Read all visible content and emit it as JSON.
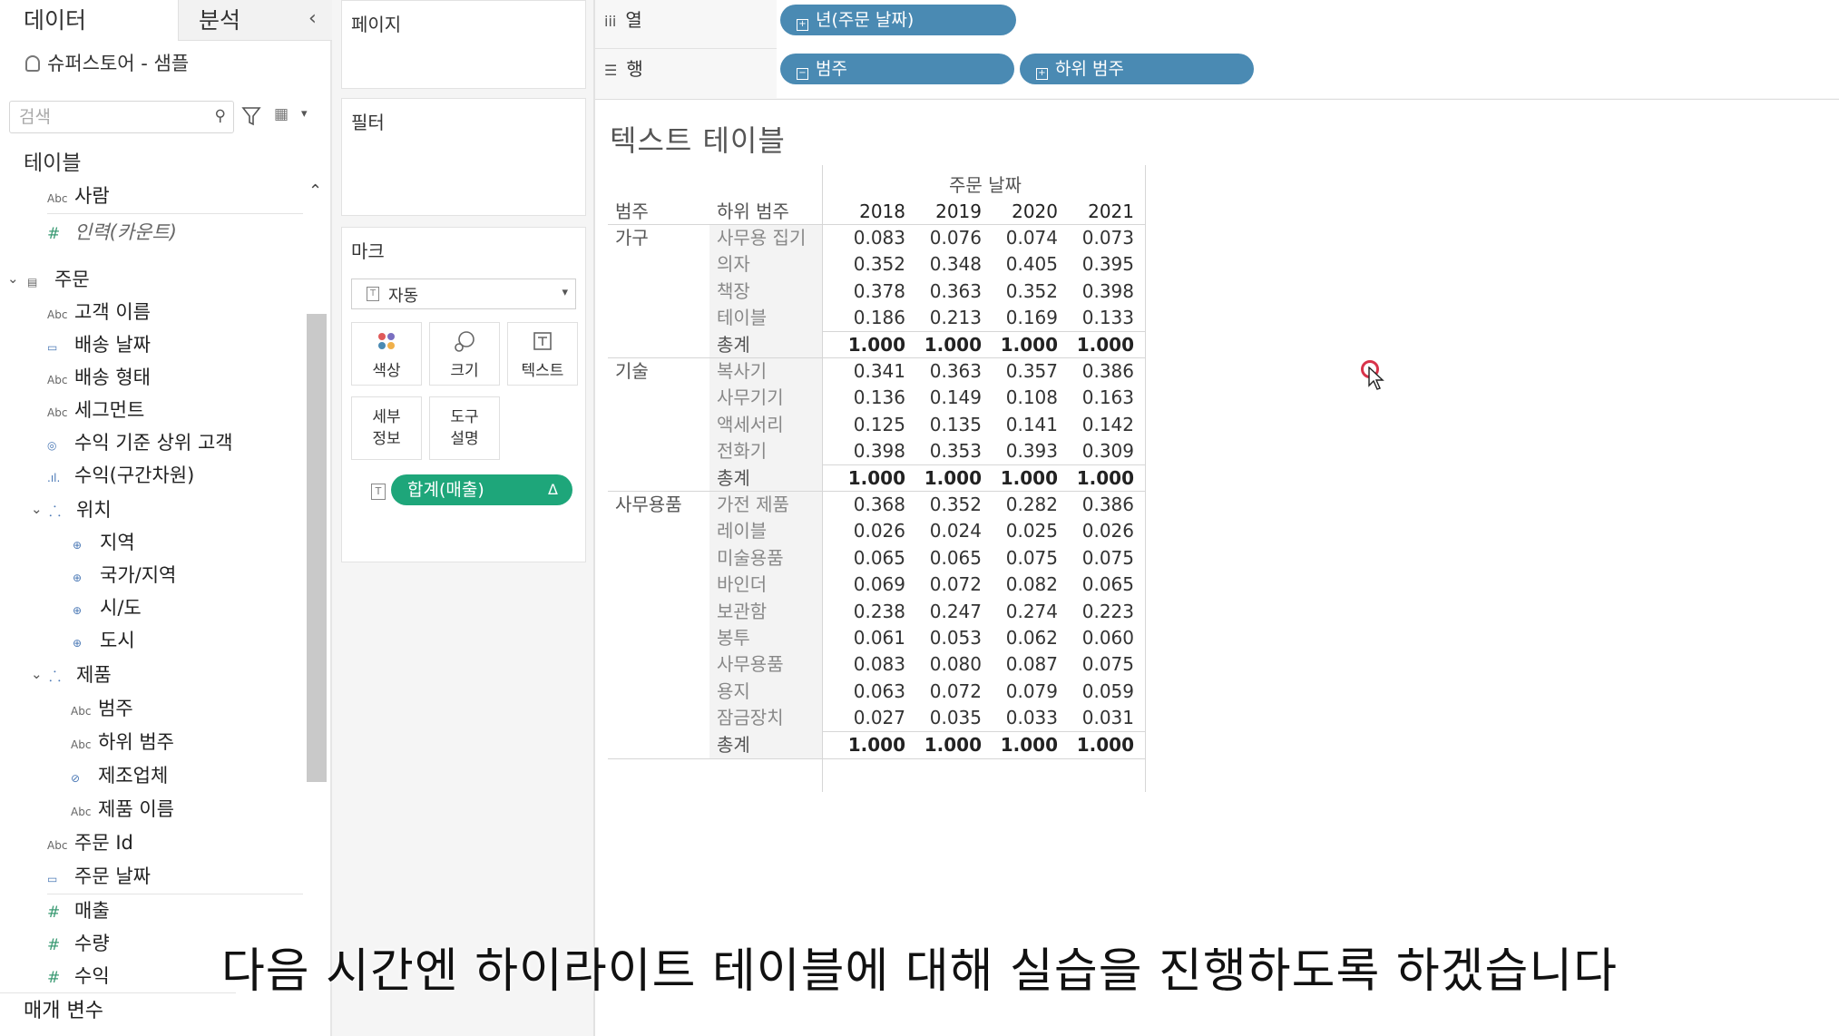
{
  "data_pane": {
    "tab_data": "데이터",
    "tab_analysis": "분석",
    "collapse_icon": "chevron-left-icon",
    "datasource": "슈퍼스토어 - 샘플",
    "search_placeholder": "검색",
    "tables_label": "테이블",
    "fields": {
      "person": "사람",
      "entry_count": "인력(카운트)",
      "orders": "주문",
      "customer_name": "고객 이름",
      "ship_date": "배송 날짜",
      "ship_mode": "배송 형태",
      "segment": "세그먼트",
      "top_customers": "수익 기준 상위 고객",
      "profit_bin": "수익(구간차원)",
      "location": "위치",
      "region": "지역",
      "country": "국가/지역",
      "state": "시/도",
      "city": "도시",
      "product": "제품",
      "category": "범주",
      "sub_category": "하위 범주",
      "manufacturer": "제조업체",
      "product_name": "제품 이름",
      "order_id": "주문 Id",
      "order_date": "주문 날짜",
      "sales": "매출",
      "quantity": "수량",
      "profit": "수익"
    },
    "parameters_label": "매개 변수"
  },
  "cards": {
    "pages": "페이지",
    "filters": "필터",
    "marks": "마크",
    "mark_type": "자동",
    "color": "색상",
    "size": "크기",
    "text": "텍스트",
    "detail_1": "세부",
    "detail_2": "정보",
    "tooltip_1": "도구",
    "tooltip_2": "설명",
    "sum_pill": "합계(매출)",
    "sum_pill_delta": "Δ"
  },
  "shelves": {
    "columns_label": "열",
    "rows_label": "행",
    "columns_pill": "년(주문 날짜)",
    "rows_pill_1": "범주",
    "rows_pill_2": "하위 범주"
  },
  "view": {
    "title": "텍스트 테이블",
    "col_group_header": "주문 날짜",
    "header_category": "범주",
    "header_subcategory": "하위 범주",
    "years": [
      "2018",
      "2019",
      "2020",
      "2021"
    ],
    "groups": [
      {
        "category": "가구",
        "rows": [
          {
            "sub": "사무용 집기",
            "values": [
              "0.083",
              "0.076",
              "0.074",
              "0.073"
            ]
          },
          {
            "sub": "의자",
            "values": [
              "0.352",
              "0.348",
              "0.405",
              "0.395"
            ]
          },
          {
            "sub": "책장",
            "values": [
              "0.378",
              "0.363",
              "0.352",
              "0.398"
            ]
          },
          {
            "sub": "테이블",
            "values": [
              "0.186",
              "0.213",
              "0.169",
              "0.133"
            ]
          },
          {
            "sub": "총계",
            "values": [
              "1.000",
              "1.000",
              "1.000",
              "1.000"
            ],
            "total": true
          }
        ]
      },
      {
        "category": "기술",
        "rows": [
          {
            "sub": "복사기",
            "values": [
              "0.341",
              "0.363",
              "0.357",
              "0.386"
            ]
          },
          {
            "sub": "사무기기",
            "values": [
              "0.136",
              "0.149",
              "0.108",
              "0.163"
            ]
          },
          {
            "sub": "액세서리",
            "values": [
              "0.125",
              "0.135",
              "0.141",
              "0.142"
            ]
          },
          {
            "sub": "전화기",
            "values": [
              "0.398",
              "0.353",
              "0.393",
              "0.309"
            ]
          },
          {
            "sub": "총계",
            "values": [
              "1.000",
              "1.000",
              "1.000",
              "1.000"
            ],
            "total": true
          }
        ]
      },
      {
        "category": "사무용품",
        "rows": [
          {
            "sub": "가전 제품",
            "values": [
              "0.368",
              "0.352",
              "0.282",
              "0.386"
            ]
          },
          {
            "sub": "레이블",
            "values": [
              "0.026",
              "0.024",
              "0.025",
              "0.026"
            ]
          },
          {
            "sub": "미술용품",
            "values": [
              "0.065",
              "0.065",
              "0.075",
              "0.075"
            ]
          },
          {
            "sub": "바인더",
            "values": [
              "0.069",
              "0.072",
              "0.082",
              "0.065"
            ]
          },
          {
            "sub": "보관함",
            "values": [
              "0.238",
              "0.247",
              "0.274",
              "0.223"
            ]
          },
          {
            "sub": "봉투",
            "values": [
              "0.061",
              "0.053",
              "0.062",
              "0.060"
            ]
          },
          {
            "sub": "사무용품",
            "values": [
              "0.083",
              "0.080",
              "0.087",
              "0.075"
            ]
          },
          {
            "sub": "용지",
            "values": [
              "0.063",
              "0.072",
              "0.079",
              "0.059"
            ]
          },
          {
            "sub": "잠금장치",
            "values": [
              "0.027",
              "0.035",
              "0.033",
              "0.031"
            ]
          },
          {
            "sub": "총계",
            "values": [
              "1.000",
              "1.000",
              "1.000",
              "1.000"
            ],
            "total": true
          }
        ]
      }
    ]
  },
  "subtitle": "다음 시간엔 하이라이트 테이블에 대해 실습을 진행하도록 하겠습니다",
  "colors": {
    "dimension_pill": "#4a8ab3",
    "measure_pill": "#1ea67a",
    "cursor_ring": "#d8334a"
  }
}
